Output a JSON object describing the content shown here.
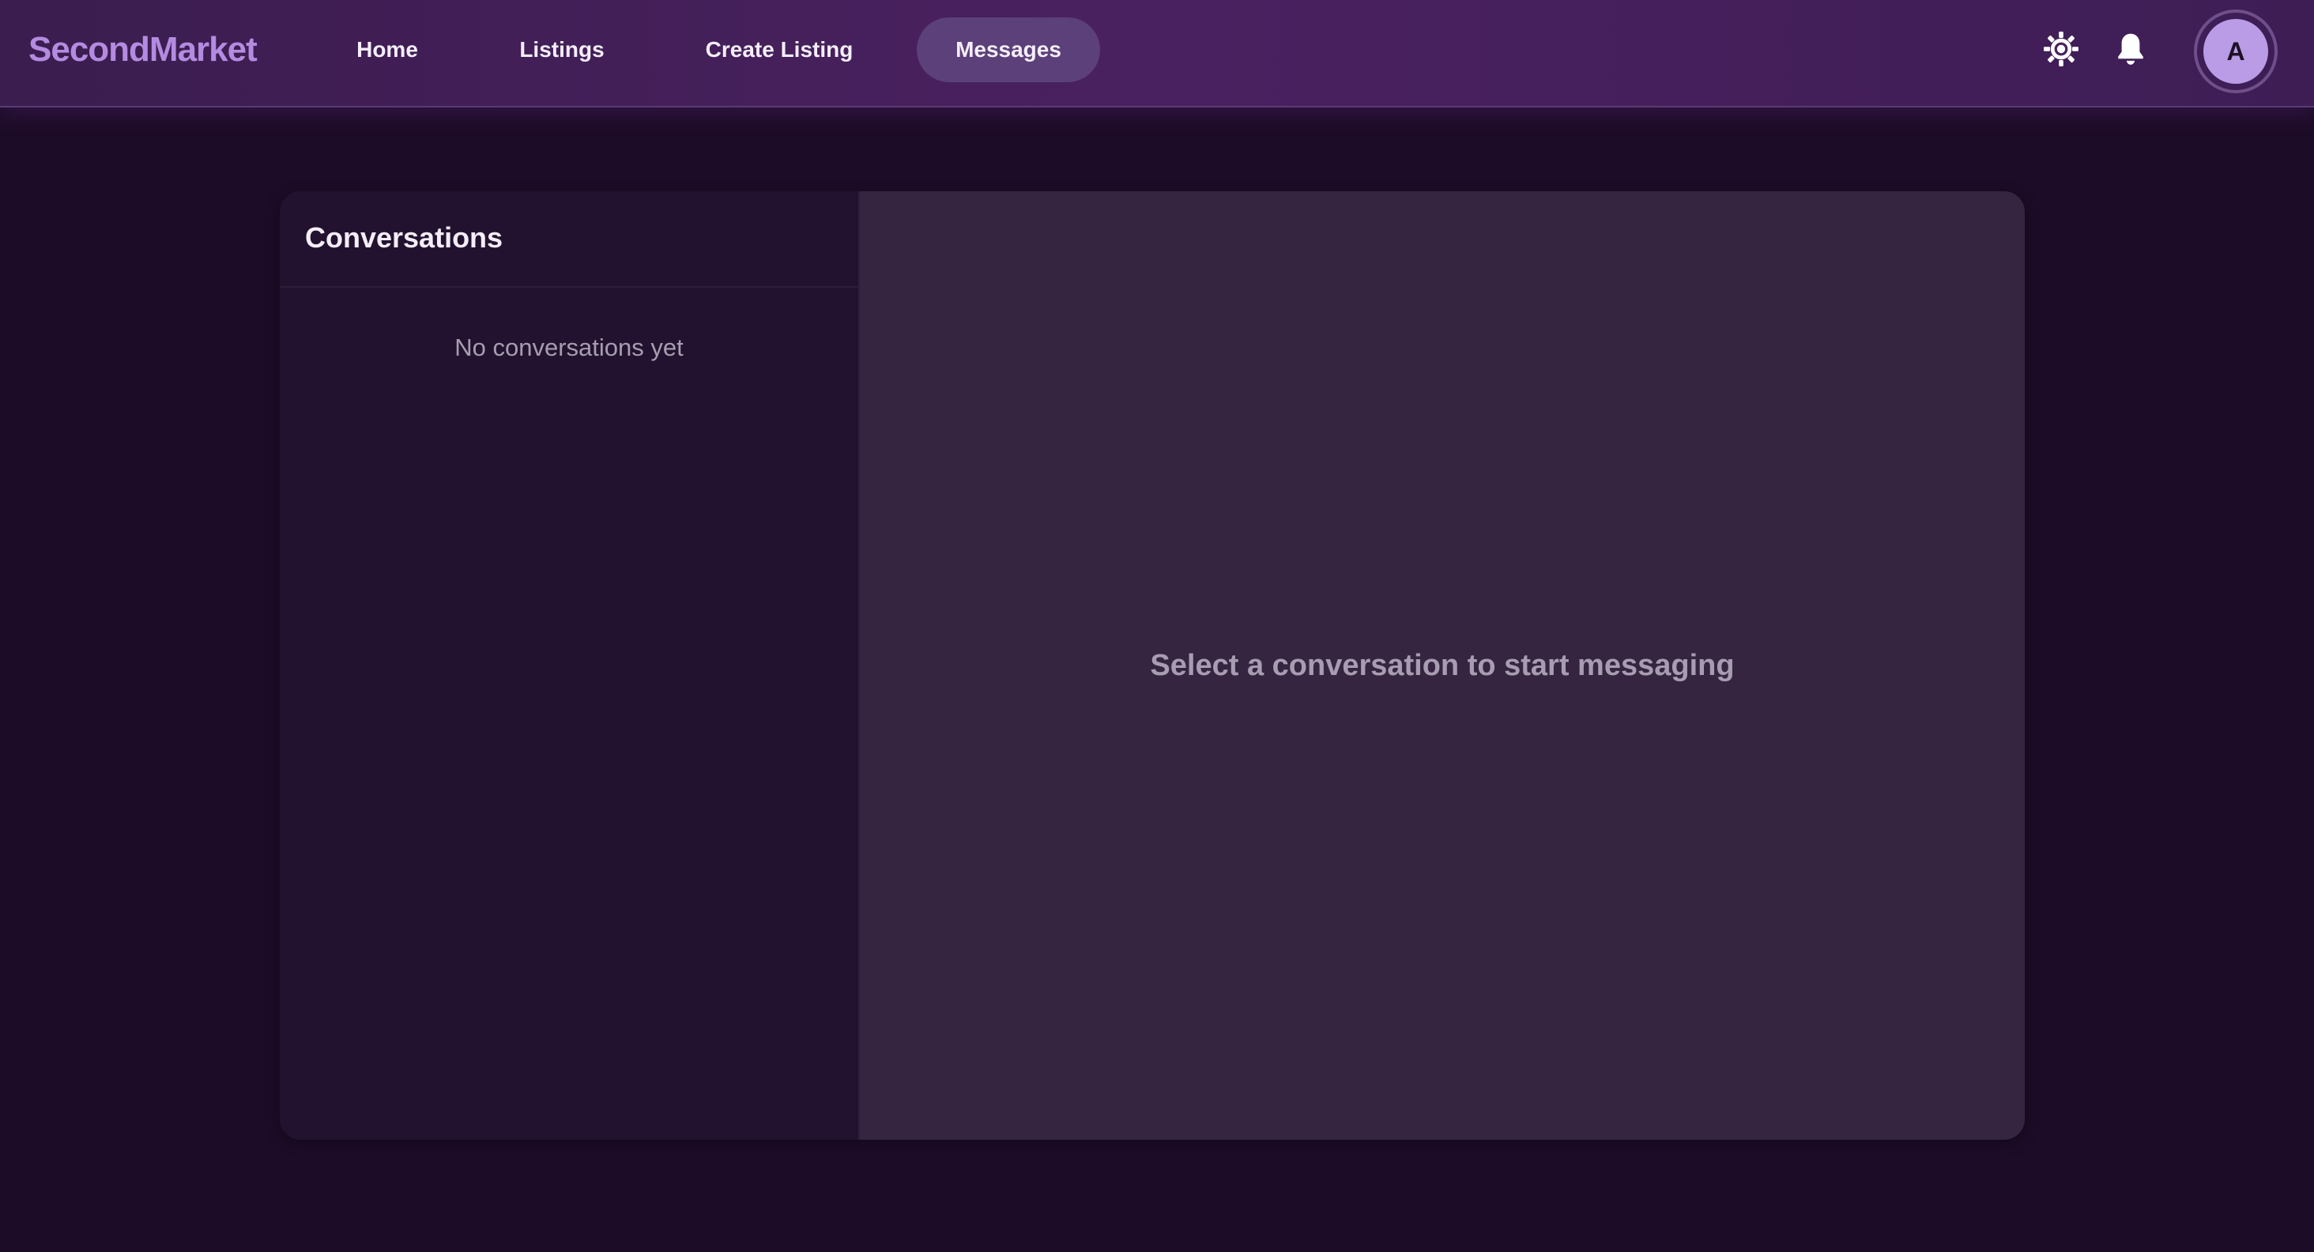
{
  "app": {
    "brand": "SecondMarket"
  },
  "nav": {
    "items": [
      {
        "label": "Home",
        "active": false
      },
      {
        "label": "Listings",
        "active": false
      },
      {
        "label": "Create Listing",
        "active": false
      },
      {
        "label": "Messages",
        "active": true
      }
    ]
  },
  "header_actions": {
    "theme_icon": "sun-icon",
    "notifications_icon": "bell-icon",
    "avatar_initial": "A"
  },
  "conversations": {
    "title": "Conversations",
    "empty_message": "No conversations yet"
  },
  "chat": {
    "placeholder": "Select a conversation to start messaging"
  },
  "colors": {
    "background": "#1d0c27",
    "navbar": "#4a2160",
    "brand": "#b48be0",
    "active_nav": "#5c4079",
    "sidebar": "#22122f",
    "chat_area": "#352540",
    "avatar": "#b99be6"
  }
}
